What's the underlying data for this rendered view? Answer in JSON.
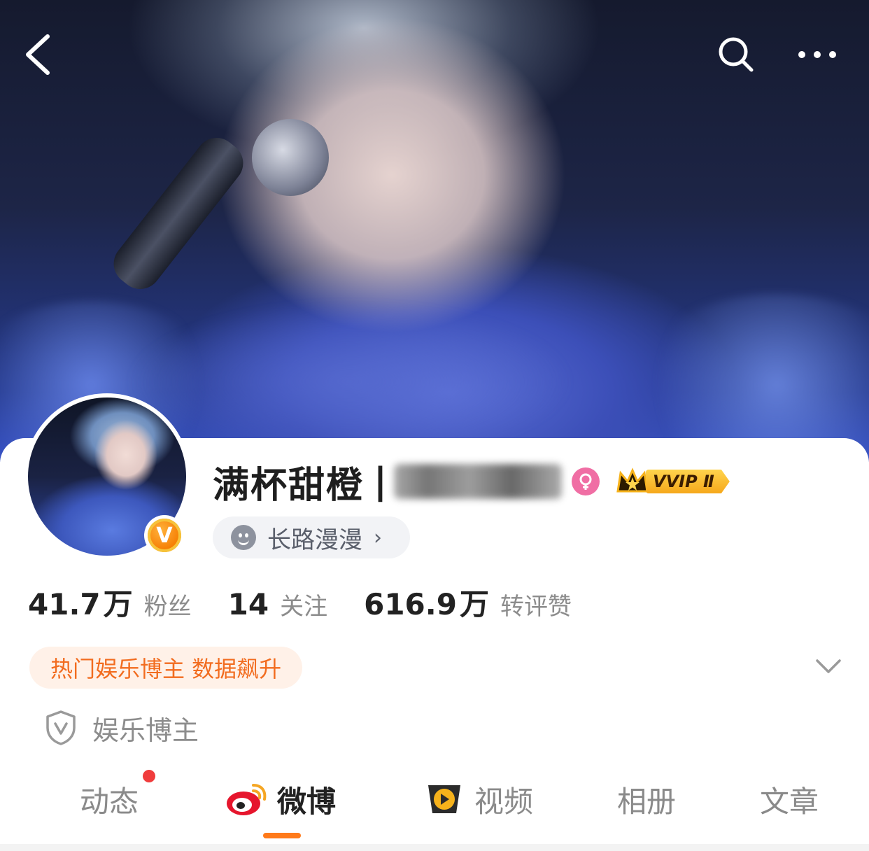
{
  "header": {
    "back_icon": "chevron-left-icon",
    "search_icon": "search-icon",
    "more_icon": "more-horizontal-icon"
  },
  "profile": {
    "name": "满杯甜橙",
    "name_separator": "|",
    "gender": "female",
    "vip_label": "VVIP Ⅱ",
    "verified_badge_letter": "V",
    "signature": "长路漫漫",
    "signature_chevron": "›"
  },
  "stats": [
    {
      "num": "41.7",
      "unit": "万",
      "label": "粉丝"
    },
    {
      "num": "14",
      "unit": "",
      "label": "关注"
    },
    {
      "num": "616.9",
      "unit": "万",
      "label": "转评赞"
    }
  ],
  "hot_tag": "热门娱乐博主 数据飙升",
  "category": {
    "icon": "shield-v-icon",
    "label": "娱乐博主"
  },
  "tabs": [
    {
      "label": "动态",
      "has_dot": true
    },
    {
      "label": "微博",
      "active": true
    },
    {
      "label": "视频"
    },
    {
      "label": "相册"
    },
    {
      "label": "文章"
    }
  ],
  "colors": {
    "accent": "#ff7a1a",
    "hot_tag_text": "#f26c1f",
    "hot_tag_bg": "#fff1e8",
    "red_dot": "#f03c3c",
    "gender_pink": "#f06ea4"
  }
}
